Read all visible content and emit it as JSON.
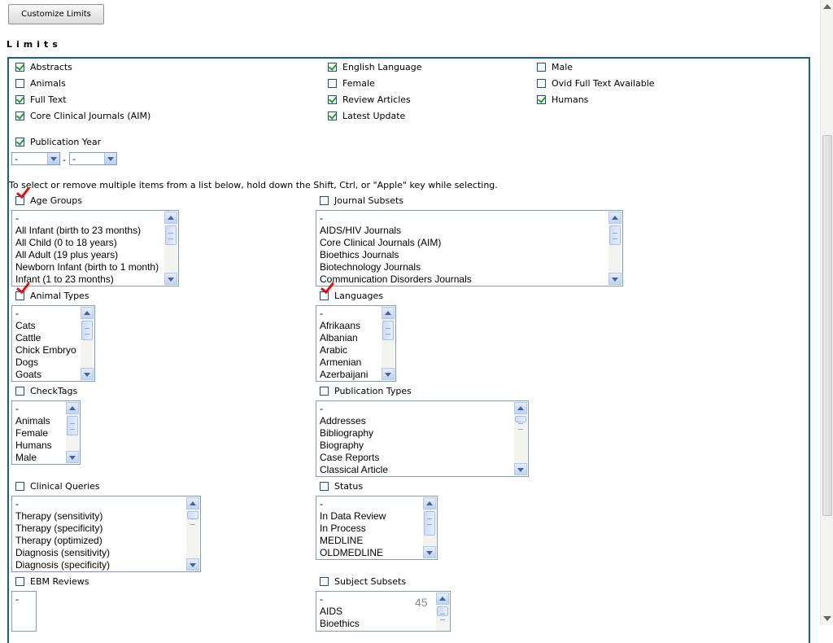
{
  "toolbar": {
    "customize_label": "Customize Limits"
  },
  "limits_heading": "Limits",
  "checkboxes": {
    "abstracts": {
      "label": "Abstracts",
      "checked": true
    },
    "english": {
      "label": "English Language",
      "checked": true
    },
    "male": {
      "label": "Male",
      "checked": false
    },
    "animals": {
      "label": "Animals",
      "checked": false
    },
    "female": {
      "label": "Female",
      "checked": false
    },
    "ovid": {
      "label": "Ovid Full Text Available",
      "checked": false
    },
    "fulltext": {
      "label": "Full Text",
      "checked": true
    },
    "review": {
      "label": "Review Articles",
      "checked": true
    },
    "humans": {
      "label": "Humans",
      "checked": true
    },
    "core": {
      "label": "Core Clinical Journals (AIM)",
      "checked": true
    },
    "latest": {
      "label": "Latest Update",
      "checked": true
    },
    "pubyear": {
      "label": "Publication Year",
      "checked": true
    }
  },
  "pubyear_selects": {
    "from": "-",
    "to": "-",
    "separator": "-"
  },
  "hint": "To select or remove multiple items from a list below, hold down the Shift, Ctrl, or \"Apple\" key while selecting.",
  "groups": {
    "age": {
      "label": "Age Groups",
      "items": [
        "-",
        "All Infant (birth to 23 months)",
        "All Child (0 to 18 years)",
        "All Adult (19 plus years)",
        "Newborn Infant (birth to 1 month)",
        "Infant (1 to 23 months)"
      ]
    },
    "journal": {
      "label": "Journal Subsets",
      "items": [
        "-",
        "AIDS/HIV Journals",
        "Core Clinical Journals (AIM)",
        "Bioethics Journals",
        "Biotechnology Journals",
        "Communication Disorders Journals"
      ]
    },
    "animal": {
      "label": "Animal Types",
      "items": [
        "-",
        "Cats",
        "Cattle",
        "Chick Embryo",
        "Dogs",
        "Goats"
      ]
    },
    "languages": {
      "label": "Languages",
      "items": [
        "-",
        "Afrikaans",
        "Albanian",
        "Arabic",
        "Armenian",
        "Azerbaijani"
      ]
    },
    "checktags": {
      "label": "CheckTags",
      "items": [
        "-",
        "Animals",
        "Female",
        "Humans",
        "Male"
      ]
    },
    "pubtypes": {
      "label": "Publication Types",
      "items": [
        "-",
        "Addresses",
        "Bibliography",
        "Biography",
        "Case Reports",
        "Classical Article"
      ]
    },
    "clinical": {
      "label": "Clinical Queries",
      "items": [
        "-",
        "Therapy (sensitivity)",
        "Therapy (specificity)",
        "Therapy (optimized)",
        "Diagnosis (sensitivity)",
        "Diagnosis (specificity)"
      ]
    },
    "status": {
      "label": "Status",
      "items": [
        "-",
        "In Data Review",
        "In Process",
        "MEDLINE",
        "OLDMEDLINE"
      ]
    },
    "ebm": {
      "label": "EBM Reviews",
      "items": [
        "-"
      ]
    },
    "subject": {
      "label": "Subject Subsets",
      "items": [
        "-",
        "AIDS",
        "Bioethics"
      ]
    }
  },
  "page_number": "45",
  "colors": {
    "panel_border": "#1b5f86",
    "check": "#21a121",
    "red_mark": "#e01010"
  }
}
